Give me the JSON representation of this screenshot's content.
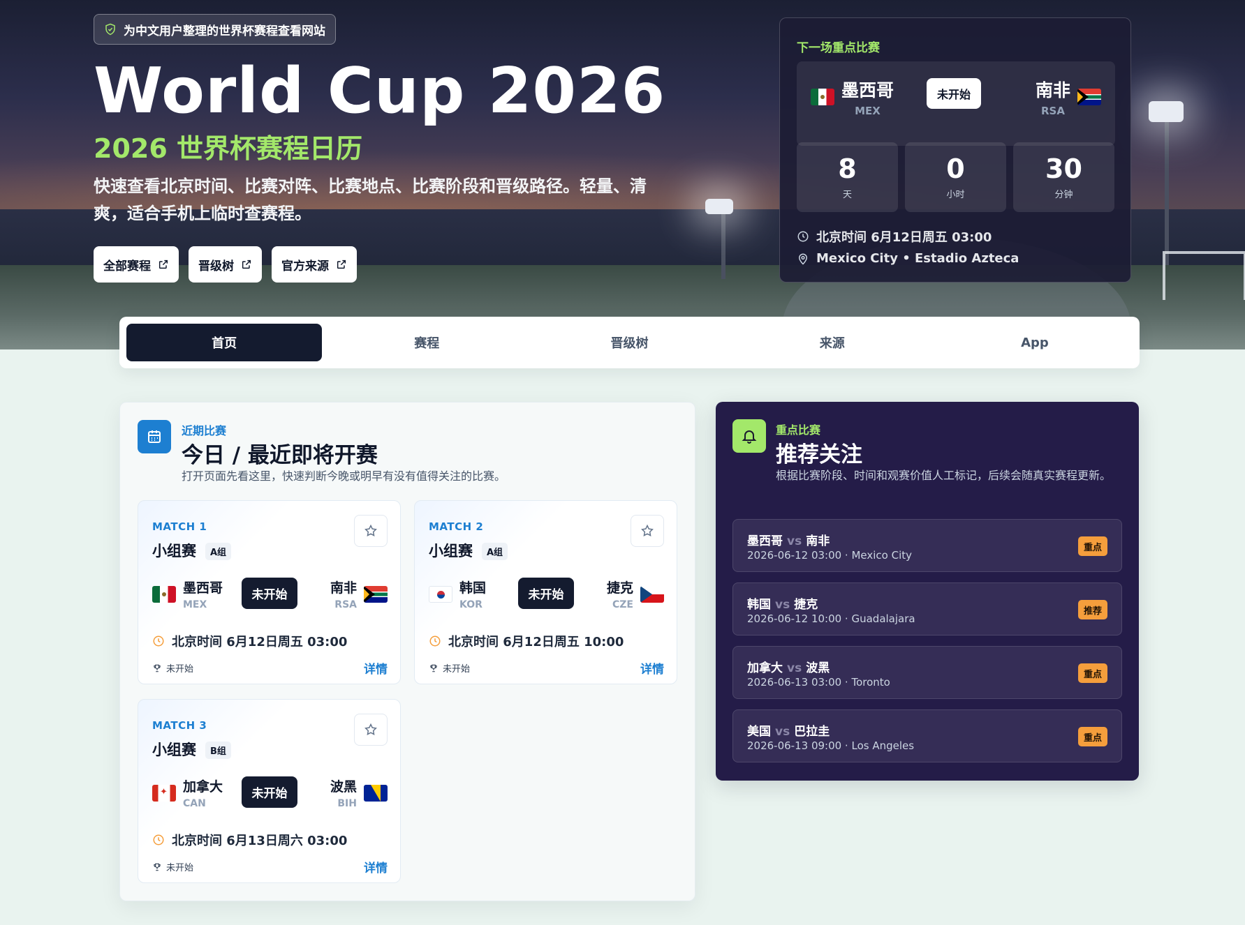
{
  "hero": {
    "badge": "为中文用户整理的世界杯赛程查看网站",
    "title": "World Cup 2026",
    "subtitle": "2026 世界杯赛程日历",
    "description": "快速查看北京时间、比赛对阵、比赛地点、比赛阶段和晋级路径。轻量、清爽，适合手机上临时查赛程。",
    "buttons": [
      {
        "label": "全部赛程",
        "icon": "external-link-icon"
      },
      {
        "label": "晋级树",
        "icon": "external-link-icon"
      },
      {
        "label": "官方来源",
        "icon": "external-link-icon"
      }
    ]
  },
  "next_match": {
    "label": "下一场重点比赛",
    "team_a": {
      "name": "墨西哥",
      "code": "MEX",
      "flag": "mexico-flag-icon"
    },
    "team_b": {
      "name": "南非",
      "code": "RSA",
      "flag": "south-africa-flag-icon"
    },
    "status": "未开始",
    "countdown": [
      {
        "value": "8",
        "unit": "天"
      },
      {
        "value": "0",
        "unit": "小时"
      },
      {
        "value": "30",
        "unit": "分钟"
      }
    ],
    "time": "北京时间 6月12日周五 03:00",
    "venue": "Mexico City • Estadio Azteca"
  },
  "tabs": [
    {
      "label": "首页",
      "active": true
    },
    {
      "label": "赛程",
      "active": false
    },
    {
      "label": "晋级树",
      "active": false
    },
    {
      "label": "来源",
      "active": false
    },
    {
      "label": "App",
      "active": false
    }
  ],
  "recent": {
    "kicker": "近期比赛",
    "title": "今日 / 最近即将开赛",
    "subtitle": "打开页面先看这里，快速判断今晚或明早有没有值得关注的比赛。",
    "matches": [
      {
        "no": "MATCH 1",
        "stage": "小组赛",
        "group": "A组",
        "team_a": {
          "name": "墨西哥",
          "code": "MEX"
        },
        "team_b": {
          "name": "南非",
          "code": "RSA"
        },
        "status": "未开始",
        "time": "北京时间 6月12日周五 03:00",
        "footer": "未开始",
        "details": "详情"
      },
      {
        "no": "MATCH 2",
        "stage": "小组赛",
        "group": "A组",
        "team_a": {
          "name": "韩国",
          "code": "KOR"
        },
        "team_b": {
          "name": "捷克",
          "code": "CZE"
        },
        "status": "未开始",
        "time": "北京时间 6月12日周五 10:00",
        "footer": "未开始",
        "details": "详情"
      },
      {
        "no": "MATCH 3",
        "stage": "小组赛",
        "group": "B组",
        "team_a": {
          "name": "加拿大",
          "code": "CAN"
        },
        "team_b": {
          "name": "波黑",
          "code": "BIH"
        },
        "status": "未开始",
        "time": "北京时间 6月13日周六 03:00",
        "footer": "未开始",
        "details": "详情"
      }
    ]
  },
  "featured": {
    "kicker": "重点比赛",
    "title": "推荐关注",
    "subtitle": "根据比赛阶段、时间和观赛价值人工标记，后续会随真实赛程更新。",
    "vs_word": "vs",
    "items": [
      {
        "a": "墨西哥",
        "b": "南非",
        "detail": "2026-06-12 03:00 · Mexico City",
        "tag": "重点"
      },
      {
        "a": "韩国",
        "b": "捷克",
        "detail": "2026-06-12 10:00 · Guadalajara",
        "tag": "推荐"
      },
      {
        "a": "加拿大",
        "b": "波黑",
        "detail": "2026-06-13 03:00 · Toronto",
        "tag": "重点"
      },
      {
        "a": "美国",
        "b": "巴拉圭",
        "detail": "2026-06-13 09:00 · Los Angeles",
        "tag": "重点"
      }
    ]
  },
  "colors": {
    "accent_green": "#a3e86a",
    "dark_navy": "#141b2f",
    "featured_bg": "#241c48",
    "link_blue": "#1d7fd1",
    "tag_orange": "#f59e3c"
  }
}
